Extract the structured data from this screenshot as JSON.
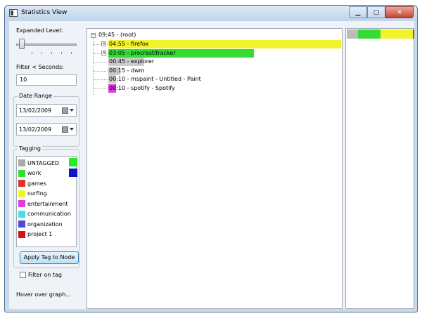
{
  "window": {
    "title": "Statistics View"
  },
  "left": {
    "expanded_level_label": "Expanded Level:",
    "filter_label": "Filter < Seconds:",
    "filter_value": "10",
    "date_range_label": "Date Range",
    "date_from": "13/02/2009",
    "date_to": "13/02/2009",
    "tagging_label": "Tagging",
    "tags": [
      {
        "name": "UNTAGGED",
        "color": "#a9a9a9"
      },
      {
        "name": "work",
        "color": "#33dd33"
      },
      {
        "name": "games",
        "color": "#e03030"
      },
      {
        "name": "surfing",
        "color": "#f2f22a"
      },
      {
        "name": "entertainment",
        "color": "#e03ce0"
      },
      {
        "name": "communication",
        "color": "#44e0e8"
      },
      {
        "name": "organization",
        "color": "#4a4ad8"
      },
      {
        "name": "project 1",
        "color": "#d41414"
      }
    ],
    "side_swatches": [
      "#22ee22",
      "#1111cc"
    ],
    "apply_button": "Apply Tag to Node",
    "filter_on_tag": "Filter on tag",
    "hover_text": "Hover over graph..."
  },
  "tree": {
    "root": "09:45 - (root)",
    "nodes": [
      {
        "label": "04:55 - firefox",
        "color": "#f2f22a",
        "fraction": 0.504,
        "expandable": true
      },
      {
        "label": "03:05 - procrastitracker",
        "color": "#33dd33",
        "fraction": 0.316,
        "expandable": true
      },
      {
        "label": "00:45 - explorer",
        "color": "#cccccc",
        "fraction": 0.077,
        "expandable": false
      },
      {
        "label": "00:15 - dwm",
        "color": "#cccccc",
        "fraction": 0.026,
        "expandable": false
      },
      {
        "label": "00:10 - mspaint - Untitled - Paint",
        "color": "#cccccc",
        "fraction": 0.017,
        "expandable": false
      },
      {
        "label": "00:10 - spotify - Spotify",
        "color": "#e03ce0",
        "fraction": 0.017,
        "expandable": false
      }
    ]
  },
  "graph": {
    "segments": [
      {
        "color": "#bbbbbb",
        "fraction": 0.17
      },
      {
        "color": "#33dd33",
        "fraction": 0.33
      },
      {
        "color": "#f2f22a",
        "fraction": 0.48
      },
      {
        "color": "#e03030",
        "fraction": 0.02
      }
    ]
  }
}
